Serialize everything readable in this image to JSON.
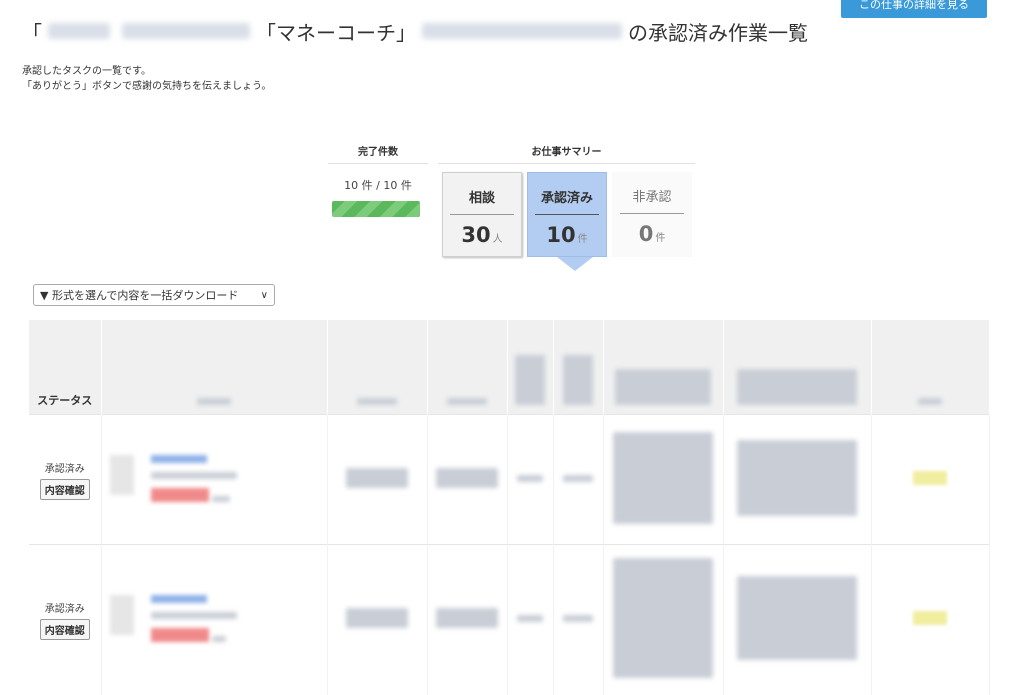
{
  "header": {
    "detail_button": "この仕事の詳細を見る",
    "title_open": "「",
    "title_app": "「マネーコーチ」",
    "title_suffix": "の承認済み作業一覧"
  },
  "intro": {
    "line1": "承認したタスクの一覧です。",
    "line2": "「ありがとう」ボタンで感謝の気持ちを伝えましょう。"
  },
  "summary": {
    "count_heading": "完了件数",
    "count_text": "10 件 / 10 件",
    "progress": 1.0,
    "summary_heading": "お仕事サマリー",
    "cards": [
      {
        "label": "相談",
        "value": "30",
        "unit": "人"
      },
      {
        "label": "承認済み",
        "value": "10",
        "unit": "件"
      },
      {
        "label": "非承認",
        "value": "0",
        "unit": "件"
      }
    ]
  },
  "download": {
    "label": "▼ 形式を選んで内容を一括ダウンロード",
    "chevron": "∨"
  },
  "table": {
    "status_header": "ステータス",
    "rows": [
      {
        "status": "承認済み",
        "button": "内容確認"
      },
      {
        "status": "承認済み",
        "button": "内容確認"
      }
    ]
  },
  "colors": {
    "accent": "#3a9ad9",
    "approved_card": "#b3cdf2",
    "progress": "#5cb85c"
  }
}
